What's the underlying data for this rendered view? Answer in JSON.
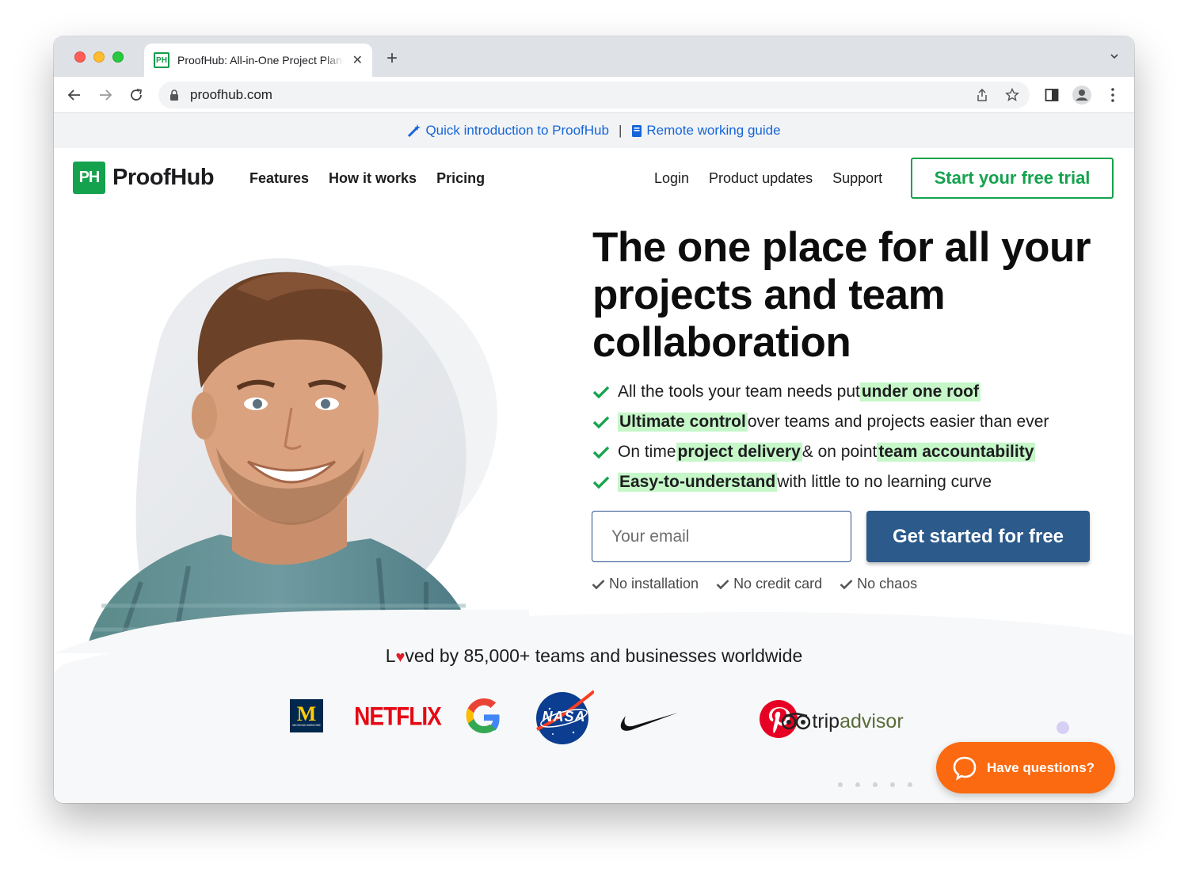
{
  "browser": {
    "tab_title": "ProofHub: All-in-One Project Planner",
    "favicon_text": "PH",
    "url": "proofhub.com"
  },
  "announcement": {
    "link1": "Quick introduction to ProofHub",
    "separator": "|",
    "link2": "Remote working guide"
  },
  "nav": {
    "logo_mark": "PH",
    "logo_text": "ProofHub",
    "left_links": [
      "Features",
      "How it works",
      "Pricing"
    ],
    "right_links": [
      "Login",
      "Product updates",
      "Support"
    ],
    "trial_button": "Start your free trial"
  },
  "hero": {
    "headline": "The one place for all your projects and team collaboration",
    "features": [
      {
        "pre": "All the tools your team needs put ",
        "hl1": "under one roof",
        "mid": "",
        "hl2": "",
        "post": ""
      },
      {
        "pre": "",
        "hl1": "Ultimate control",
        "mid": " over teams and projects easier than ever",
        "hl2": "",
        "post": ""
      },
      {
        "pre": "On time ",
        "hl1": "project delivery",
        "mid": " & on point ",
        "hl2": "team accountability",
        "post": ""
      },
      {
        "pre": "",
        "hl1": "Easy-to-understand",
        "mid": " with little to no learning curve",
        "hl2": "",
        "post": ""
      }
    ],
    "email_placeholder": "Your email",
    "cta": "Get started for free",
    "perks": [
      "No installation",
      "No credit card",
      "No chaos"
    ]
  },
  "social_proof": {
    "loved_pre": "L",
    "loved_post": "ved by 85,000+ teams and businesses worldwide",
    "brands": [
      "michigan-medicine",
      "NETFLIX",
      "google",
      "NASA",
      "nike",
      "pinterest",
      "tripadvisor"
    ],
    "michigan_letter": "M",
    "michigan_sub": "MICHIGAN MEDICINE",
    "netflix": "NETFLIX",
    "nasa": "NASA",
    "trip": "trip",
    "advisor": "advisor"
  },
  "chat": {
    "label": "Have questions?"
  },
  "colors": {
    "brand_green": "#15a24e",
    "cta_blue": "#2b5a8b",
    "highlight": "#c5f7c8",
    "chat_orange": "#fb6a10",
    "link_blue": "#1565d8"
  }
}
